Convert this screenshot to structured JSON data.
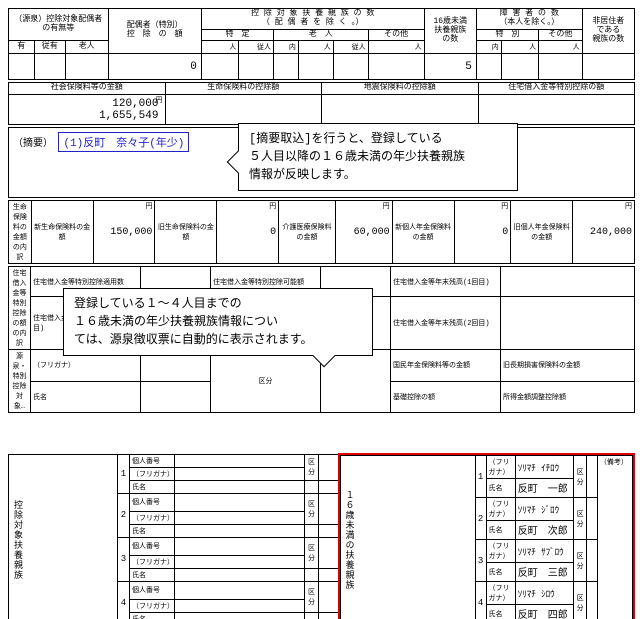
{
  "top": {
    "col1_l1": "（源泉）控除対象配偶者",
    "col1_l2": "の有無等",
    "col1_sub": "老人",
    "col2": "配偶者（特別）",
    "col2b": "控　除　の　額",
    "col3_l1": "控 除 対 象 扶 養 親 族 の 数",
    "col3_l2": "（ 配 偶 者 を 除 く 。）",
    "col3_sub1": "特　定",
    "col3_sub2": "老　人",
    "col3_sub3": "その他",
    "col4_l1": "16歳未満",
    "col4_l2": "扶養親族",
    "col4_l3": "の数",
    "col5_l1": "障 害 者 の 数",
    "col5_l2": "（本人を除く。）",
    "col5_sub1": "特　別",
    "col5_sub2": "その他",
    "col6_l1": "非居住者",
    "col6_l2": "である",
    "col6_l3": "親族の数",
    "ari": "有",
    "juari": "従有",
    "nin": "人",
    "junin": "従人",
    "uchi": "内",
    "val_haitoku": "0",
    "val_under16": "5"
  },
  "row2": {
    "c1": "社会保険料等の金額",
    "c2": "生命保険料の控除額",
    "c3": "地震保険料の控除額",
    "c4": "住宅借入金等特別控除の額",
    "yen": "円",
    "v1a": "120,000",
    "v1b": "1,655,549"
  },
  "tekiyo": {
    "label": "（摘要）",
    "entry": "(1)反町　奈々子(年少)"
  },
  "callout1_l1": "[摘要取込]を行うと、登録している",
  "callout1_l2": "５人目以降の１６歳未満の年少扶養親族",
  "callout1_l3": "情報が反映します。",
  "ins": {
    "side": "生命保険料の金額の内訳",
    "c1h": "新生命保険料の金額",
    "c1v": "150,000",
    "c2h": "旧生命保険料の金額",
    "c2v": "0",
    "c3h": "介護医療保険料の金額",
    "c3v": "60,000",
    "c4h": "新個人年金保険料の金額",
    "c4v": "0",
    "c5h": "旧個人年金保険料の金額",
    "c5v": "240,000",
    "yen": "円"
  },
  "callout2_l1": "登録している１～４人目までの",
  "callout2_l2": "１６歳未満の年少扶養親族情報につい",
  "callout2_l3": "ては、源泉徴収票に自動的に表示されます。",
  "midrows": {
    "side1": "住宅借入金等特別控除の額の内訳",
    "r1a": "住宅借入金等特別控除適用数",
    "r1b": "住宅借入金等特別控除可能額",
    "r1c": "住宅借入金等年末残高(1回目)",
    "r2a": "住宅借入金等特別控除区分(2回目)",
    "r2c": "住宅借入金等年末残高(2回目)",
    "side2": "源泉・特別控除対象…",
    "r3a": "（フリガナ）",
    "r3b": "氏名",
    "r3c": "区分",
    "r3right1": "国民年金保険料等の金額",
    "r3right2": "旧長期損害保険料の金額",
    "r4right1": "基礎控除の額",
    "r4right2": "所得金額調整控除額"
  },
  "dep": {
    "side_left": "控除対象扶養親族",
    "side_right": "１６歳未満の扶養親族",
    "kojin": "個人番号",
    "furi": "（フリガナ）",
    "name": "氏名",
    "kubun": "区分",
    "biko": "（備考）",
    "n1": "1",
    "n2": "2",
    "n3": "3",
    "n4": "4",
    "r1_f": "ｿﾘﾏﾁ ｲﾁﾛｳ",
    "r1_n": "反町　一郎",
    "r2_f": "ｿﾘﾏﾁ ｼﾞﾛｳ",
    "r2_n": "反町　次郎",
    "r3_f": "ｿﾘﾏﾁ ｻﾌﾞﾛｳ",
    "r3_n": "反町　三郎",
    "r4_f": "ｿﾘﾏﾁ ｼﾛｳ",
    "r4_n": "反町　四郎"
  }
}
